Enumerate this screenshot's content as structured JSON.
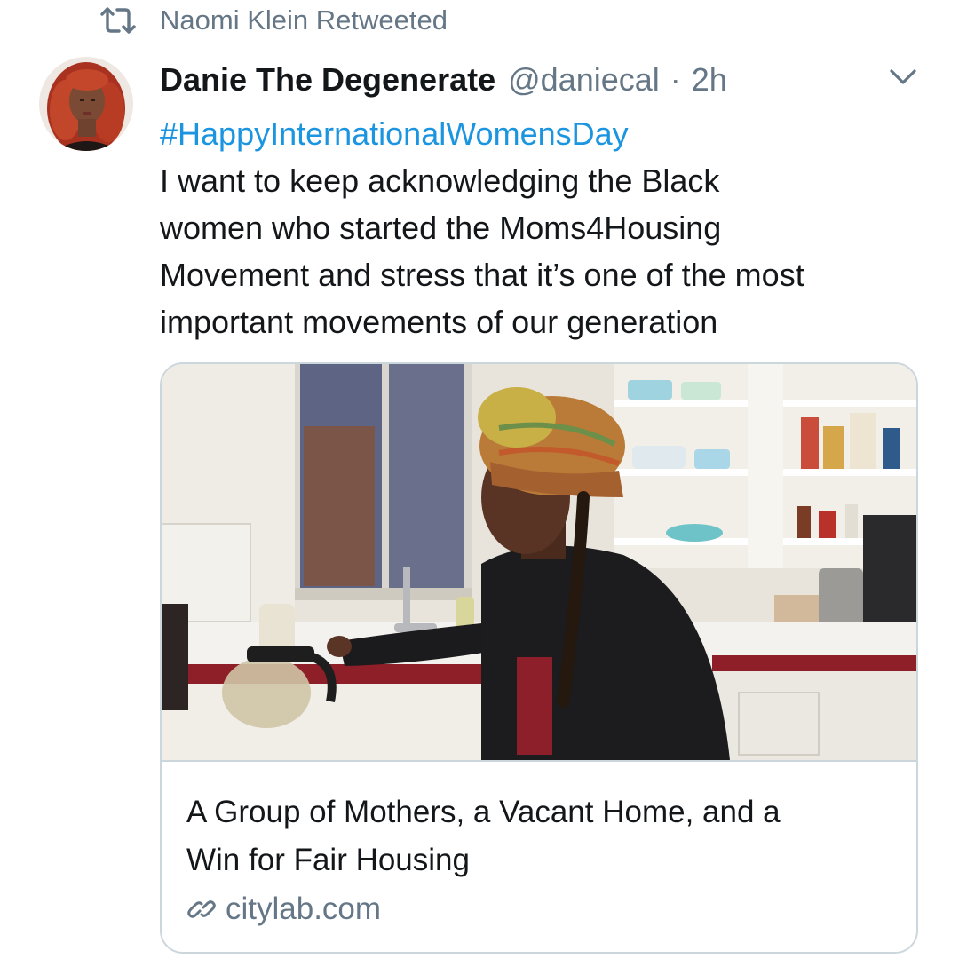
{
  "retweet_context": {
    "text": "Naomi Klein Retweeted",
    "icon": "retweet-icon"
  },
  "author": {
    "display_name": "Danie The Degenerate",
    "handle": "@daniecal",
    "separator": "·",
    "timestamp": "2h"
  },
  "menu_icon": "chevron-down-icon",
  "tweet": {
    "hashtag": "#HappyInternationalWomensDay",
    "lines": [
      "I want to keep acknowledging the Black",
      "women who started the Moms4Housing",
      "Movement and stress that it’s one of the most",
      "important movements of our generation"
    ]
  },
  "card": {
    "title_lines": [
      "A Group of Mothers, a Vacant Home, and a",
      "Win for Fair Housing"
    ],
    "domain": "citylab.com",
    "link_icon": "link-icon"
  },
  "colors": {
    "hashtag": "#1b95e0",
    "secondary_text": "#657786",
    "primary_text": "#14171a",
    "border": "#ccd6dd"
  }
}
